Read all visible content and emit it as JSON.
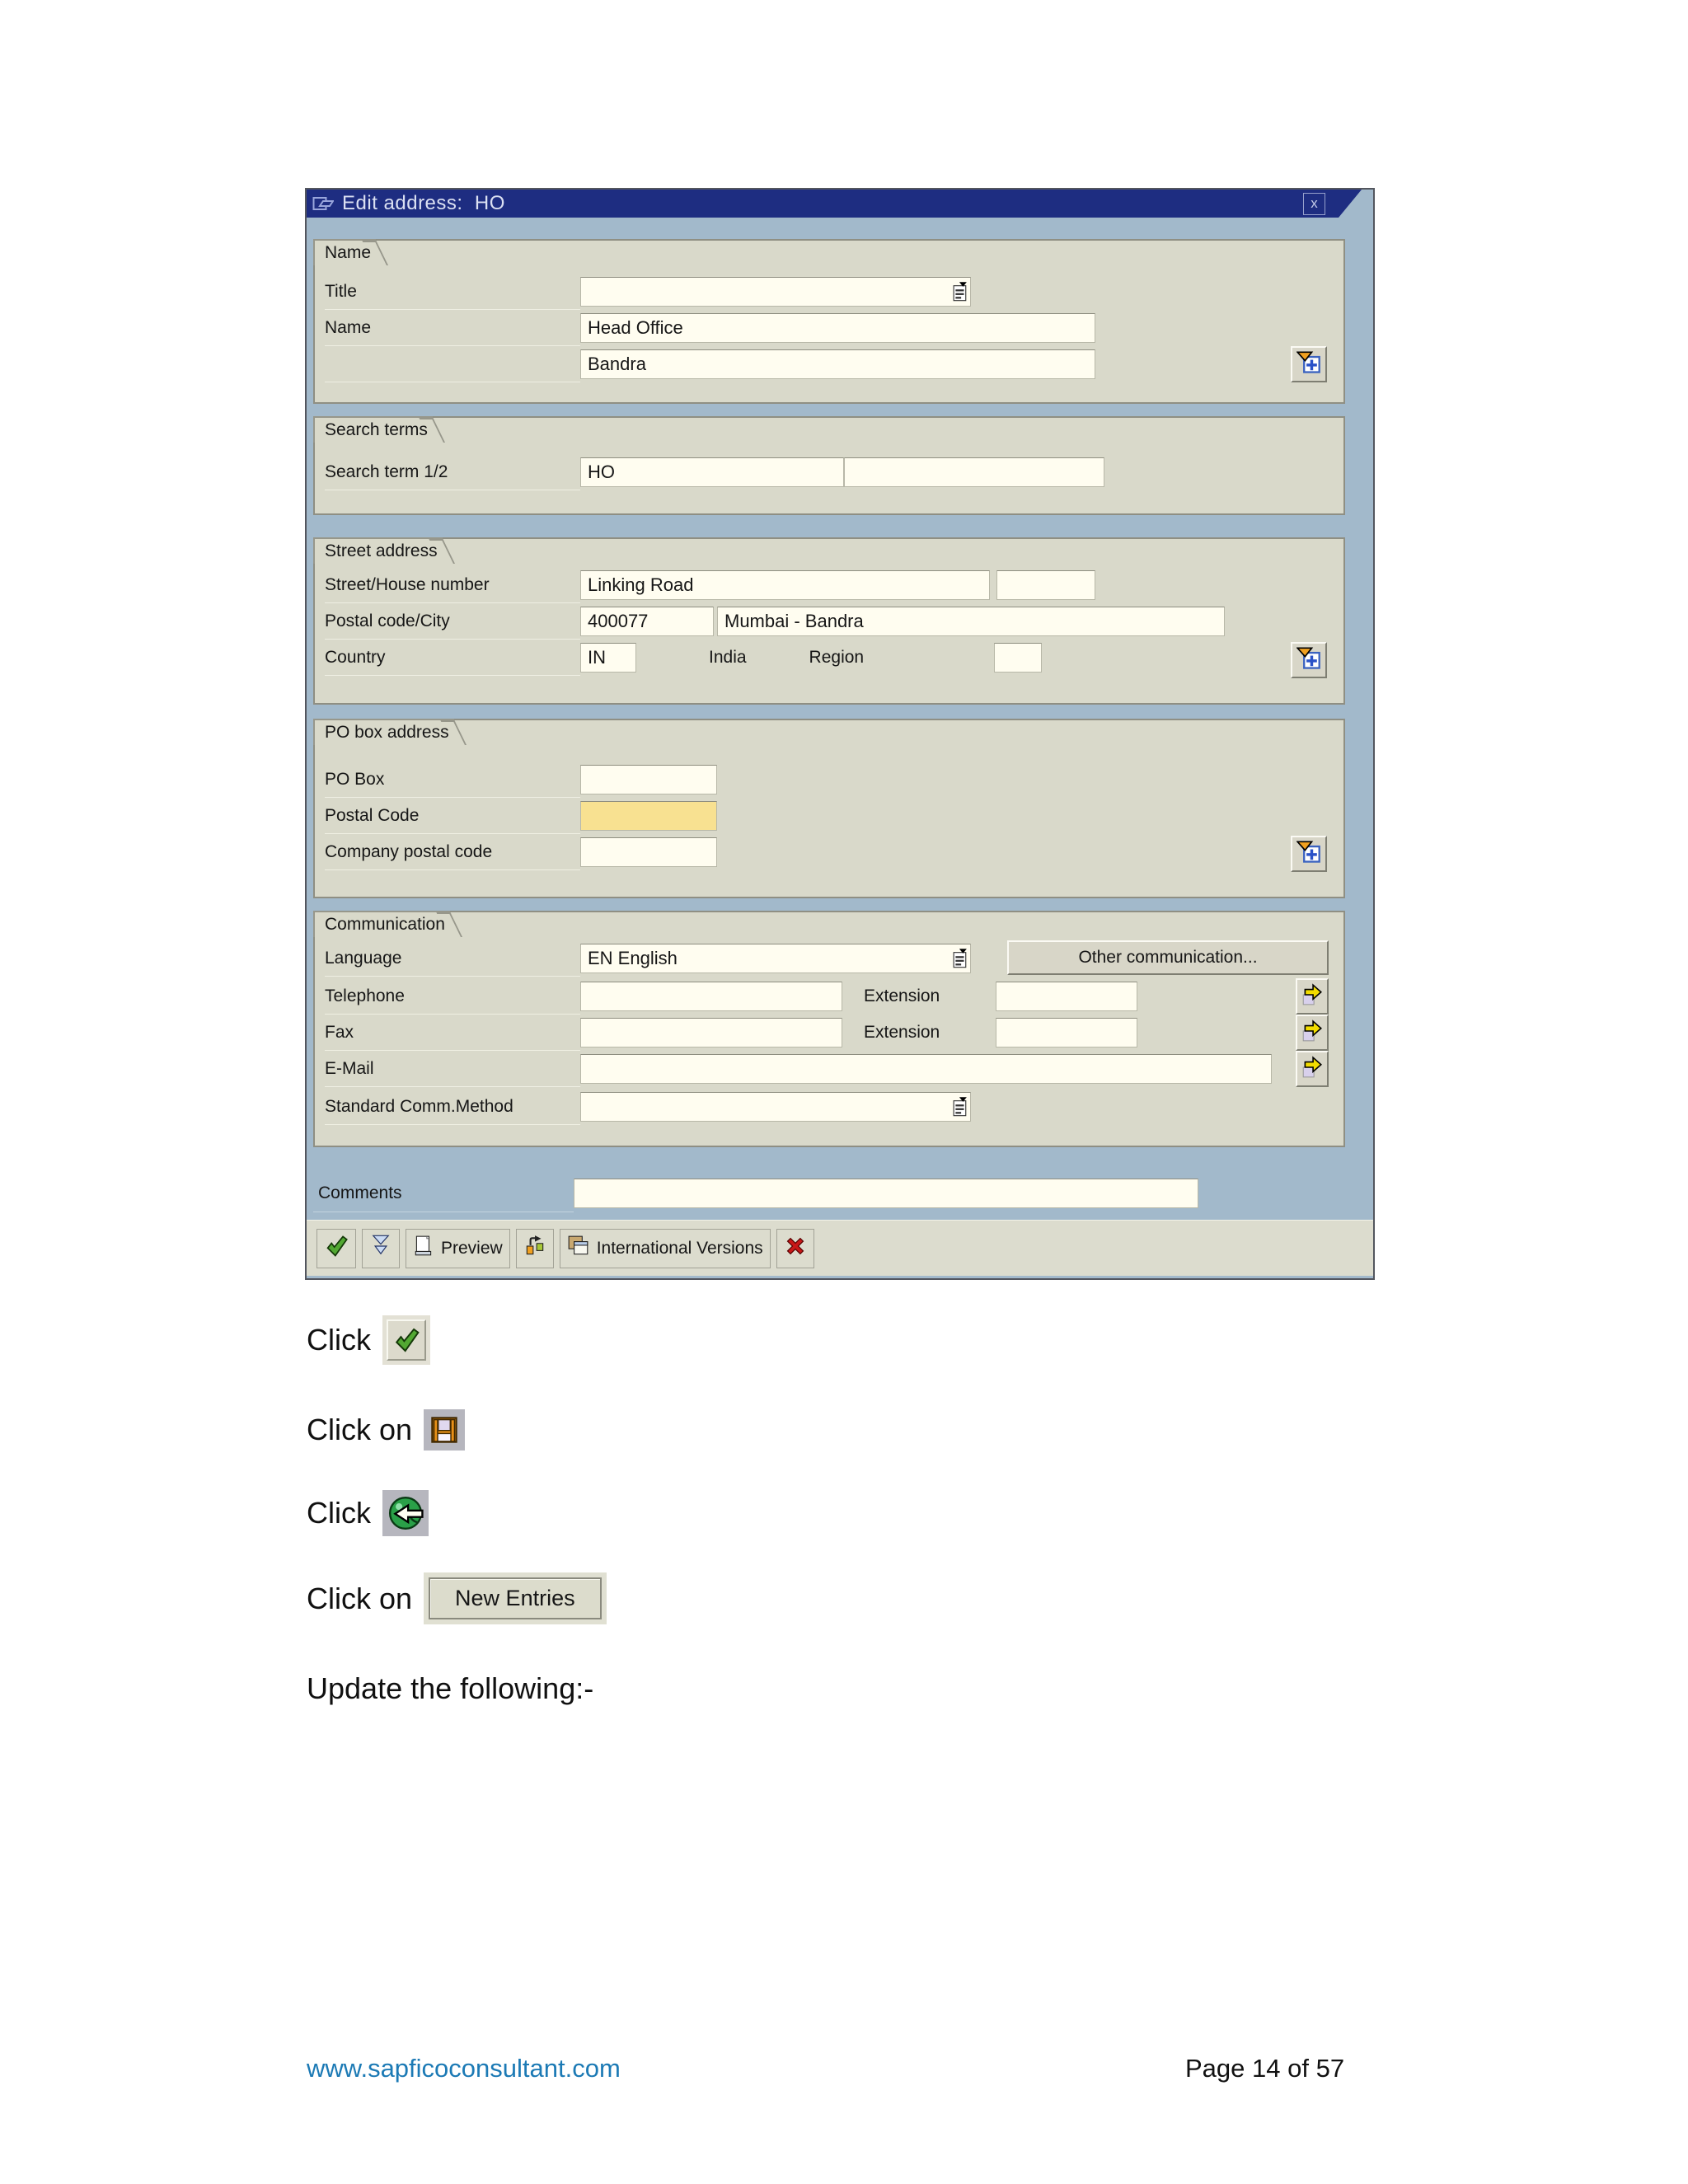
{
  "dialog": {
    "title": "Edit address:  HO",
    "close_glyph": "x",
    "name_section": {
      "tab": "Name",
      "title_label": "Title",
      "title_value": "",
      "name_label": "Name",
      "name_value": "Head Office",
      "name2_value": "Bandra"
    },
    "search_section": {
      "tab": "Search terms",
      "label": "Search term 1/2",
      "value1": "HO",
      "value2": ""
    },
    "street_section": {
      "tab": "Street address",
      "street_label": "Street/House number",
      "street_value": "Linking Road",
      "street_extra_value": "",
      "postal_label": "Postal code/City",
      "postal_value": "400077",
      "city_value": "Mumbai - Bandra",
      "country_label": "Country",
      "country_value": "IN",
      "country_name": "India",
      "region_label": "Region",
      "region_value": ""
    },
    "pobox_section": {
      "tab": "PO box address",
      "pobox_label": "PO Box",
      "pobox_value": "",
      "postalcode_label": "Postal Code",
      "postalcode_value": "",
      "company_label": "Company postal code",
      "company_value": ""
    },
    "comm_section": {
      "tab": "Communication",
      "language_label": "Language",
      "language_value": "EN English",
      "other_comm_button": "Other communication...",
      "telephone_label": "Telephone",
      "telephone_value": "",
      "extension_label": "Extension",
      "extension_value": "",
      "fax_label": "Fax",
      "fax_value": "",
      "fax_extension_value": "",
      "email_label": "E-Mail",
      "email_value": "",
      "stdcomm_label": "Standard Comm.Method",
      "stdcomm_value": ""
    },
    "comments_label": "Comments",
    "comments_value": "",
    "toolbar": {
      "preview_label": "Preview",
      "intl_label": "International Versions"
    }
  },
  "instructions": {
    "step1_text": "Click",
    "step2_text": "Click on",
    "step3_text": "Click",
    "step4_text": "Click on",
    "new_entries_button": "New Entries",
    "step5_text": "Update the following:-"
  },
  "footer": {
    "website": "www.sapficoconsultant.com",
    "page_number": "Page 14 of 57"
  },
  "icons": {
    "titlebar": "dialog-window-icon",
    "close": "close-icon",
    "dropdown": "combobox-dropdown-icon",
    "more_fields": "more-fields-filter-plus-icon",
    "comm_arrow": "forward-arrow-note-icon",
    "check": "green-checkmark-icon",
    "double_down": "double-chevron-down-icon",
    "printer": "print-preview-icon",
    "transport": "address-version-icon",
    "intl": "international-versions-icon",
    "cancel": "red-x-icon",
    "save": "save-floppy-icon",
    "back": "back-green-globe-icon"
  },
  "colors": {
    "titlebar_navy": "#1e2d81",
    "dialog_blue": "#a2b9cb",
    "panel_beige": "#d9d9ca",
    "input_cream": "#fffdf0",
    "focused_yellow": "#f8e191",
    "toolbar_beige": "#dcdcce",
    "link_blue": "#1c7ab5",
    "check_green": "#52a832",
    "cancel_red": "#c81818",
    "save_orange": "#e89018"
  }
}
